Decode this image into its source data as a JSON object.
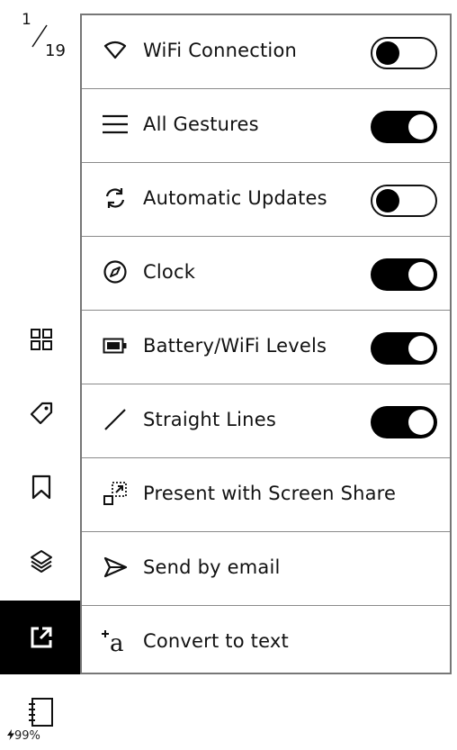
{
  "page_counter": {
    "current": "1",
    "total": "19"
  },
  "sidebar": {
    "buttons": [
      {
        "name": "grid-view",
        "icon": "grid-icon"
      },
      {
        "name": "tags",
        "icon": "tag-icon"
      },
      {
        "name": "bookmarks",
        "icon": "bookmark-icon"
      },
      {
        "name": "layers",
        "icon": "layers-icon"
      },
      {
        "name": "export",
        "icon": "export-icon",
        "active": true
      }
    ],
    "battery": "99%"
  },
  "menu": {
    "items": [
      {
        "label": "WiFi Connection",
        "icon": "wifi-icon",
        "toggle": "off"
      },
      {
        "label": "All Gestures",
        "icon": "menu-lines-icon",
        "toggle": "on"
      },
      {
        "label": "Automatic Updates",
        "icon": "sync-icon",
        "toggle": "off"
      },
      {
        "label": "Clock",
        "icon": "compass-icon",
        "toggle": "on"
      },
      {
        "label": "Battery/WiFi Levels",
        "icon": "battery-icon",
        "toggle": "on"
      },
      {
        "label": "Straight Lines",
        "icon": "line-icon",
        "toggle": "on"
      },
      {
        "label": "Present with Screen Share",
        "icon": "screen-share-icon"
      },
      {
        "label": "Send by email",
        "icon": "send-icon"
      },
      {
        "label": "Convert to text",
        "icon": "convert-text-icon"
      }
    ]
  }
}
